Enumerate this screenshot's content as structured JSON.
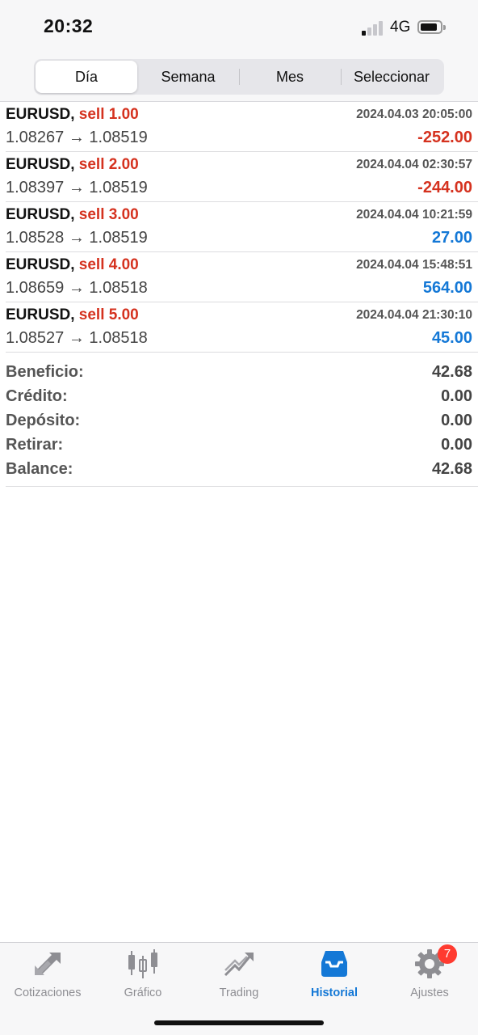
{
  "status": {
    "time": "20:32",
    "network": "4G"
  },
  "segments": [
    "Día",
    "Semana",
    "Mes",
    "Seleccionar"
  ],
  "trades": [
    {
      "symbol": "EURUSD,",
      "side": "sell 1.00",
      "time": "2024.04.03 20:05:00",
      "prices": "1.08267 → 1.08519",
      "profit": "-252.00",
      "sign": "neg"
    },
    {
      "symbol": "EURUSD,",
      "side": "sell 2.00",
      "time": "2024.04.04 02:30:57",
      "prices": "1.08397 → 1.08519",
      "profit": "-244.00",
      "sign": "neg"
    },
    {
      "symbol": "EURUSD,",
      "side": "sell 3.00",
      "time": "2024.04.04 10:21:59",
      "prices": "1.08528 → 1.08519",
      "profit": "27.00",
      "sign": "pos"
    },
    {
      "symbol": "EURUSD,",
      "side": "sell 4.00",
      "time": "2024.04.04 15:48:51",
      "prices": "1.08659 → 1.08518",
      "profit": "564.00",
      "sign": "pos"
    },
    {
      "symbol": "EURUSD,",
      "side": "sell 5.00",
      "time": "2024.04.04 21:30:10",
      "prices": "1.08527 → 1.08518",
      "profit": "45.00",
      "sign": "pos"
    }
  ],
  "summary": [
    {
      "label": "Beneficio:",
      "value": "42.68"
    },
    {
      "label": "Crédito:",
      "value": "0.00"
    },
    {
      "label": "Depósito:",
      "value": "0.00"
    },
    {
      "label": "Retirar:",
      "value": "0.00"
    },
    {
      "label": "Balance:",
      "value": "42.68"
    }
  ],
  "tabs": [
    {
      "label": "Cotizaciones",
      "icon": "quotes-arrows-icon"
    },
    {
      "label": "Gráfico",
      "icon": "candlestick-chart-icon"
    },
    {
      "label": "Trading",
      "icon": "trading-trend-icon"
    },
    {
      "label": "Historial",
      "icon": "history-inbox-icon"
    },
    {
      "label": "Ajustes",
      "icon": "gear-icon",
      "badge": "7"
    }
  ],
  "colors": {
    "loss": "#d5321f",
    "profit": "#1478d6",
    "active_tab": "#1478d6"
  }
}
